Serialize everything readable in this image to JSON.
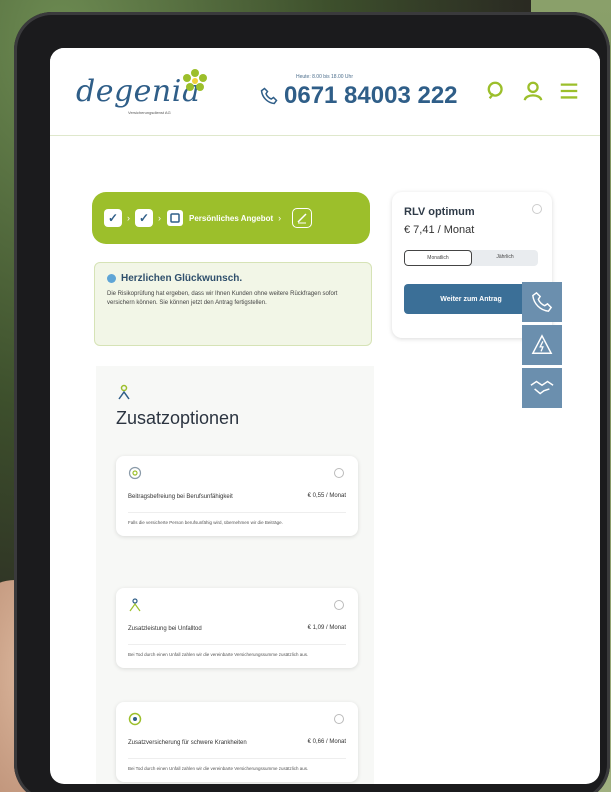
{
  "header": {
    "logo_text": "degenia",
    "logo_sub": "Versicherungsdienst AG",
    "phone_hours": "Heute: 8.00 bis 18.00 Uhr",
    "phone_number": "0671 84003 222"
  },
  "progress": {
    "current_step_label": "Persönliches Angebot",
    "check_glyph": "✓",
    "arrow_glyph": "›"
  },
  "info": {
    "title": "Herzlichen Glückwunsch.",
    "text": "Die Risikoprüfung hat ergeben, dass wir Ihnen Kunden ohne weitere Rückfragen sofort versichern können. Sie können jetzt den Antrag fertigstellen."
  },
  "tariff": {
    "name": "RLV optimum",
    "price": "€ 7,41 / Monat",
    "segments": [
      "Monatlich",
      "Jährlich"
    ],
    "cta_label": "Weiter zum Antrag"
  },
  "options": {
    "heading": "Zusatzoptionen",
    "cards": [
      {
        "name": "Beitragsbefreiung bei Berufsunfähigkeit",
        "price": "€ 0,55 / Monat",
        "desc": "Falls die versicherte Person berufsunfähig wird, übernehmen wir die Beiträge."
      },
      {
        "name": "Zusatzleistung bei Unfalltod",
        "price": "€ 1,09 / Monat",
        "desc": "Bei Tod durch einen Unfall zahlen wir die vereinbarte Versicherungssumme zusätzlich aus."
      },
      {
        "name": "Zusatzversicherung für schwere Krankheiten",
        "price": "€ 0,66 / Monat",
        "desc": "Bei Tod durch einen Unfall zahlen wir die vereinbarte Versicherungssumme zusätzlich aus."
      }
    ]
  },
  "colors": {
    "brand_green": "#9cbf2b",
    "brand_blue": "#2f5e88",
    "cta_blue": "#3b6f97",
    "side_tab_blue": "#6b8fae"
  }
}
